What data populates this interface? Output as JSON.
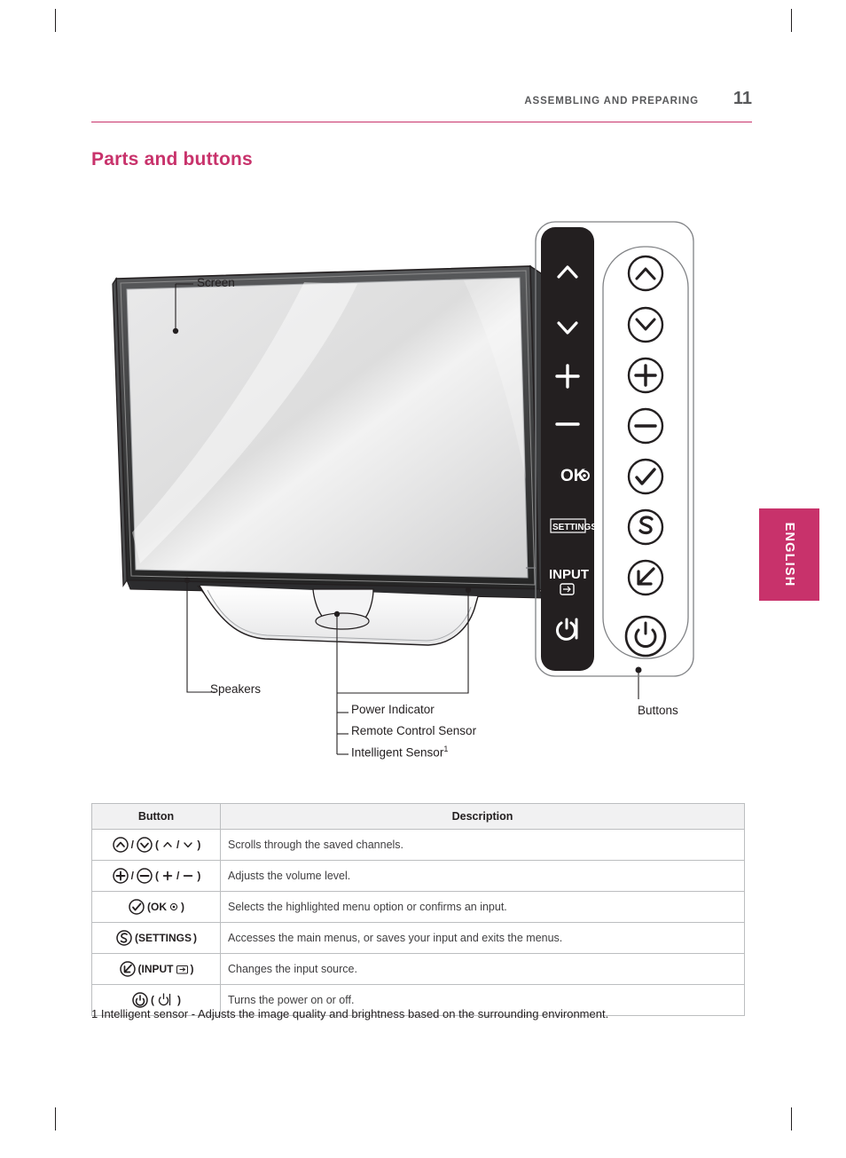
{
  "header": {
    "breadcrumb": "ASSEMBLING AND PREPARING",
    "page_number": "11",
    "accent_color": "#c8326b"
  },
  "section": {
    "title": "Parts and buttons"
  },
  "side_tab": {
    "label": "ENGLISH"
  },
  "diagram": {
    "callouts": {
      "screen": "Screen",
      "speakers": "Speakers",
      "power_indicator": "Power Indicator",
      "remote_control_sensor": "Remote Control Sensor",
      "intelligent_sensor": "Intelligent Sensor",
      "intelligent_sensor_sup": "1",
      "buttons": "Buttons"
    },
    "panel_labels": {
      "ok": "OK",
      "settings": "SETTINGS",
      "input": "INPUT"
    }
  },
  "table": {
    "headers": {
      "button": "Button",
      "description": "Description"
    },
    "rows": [
      {
        "icons": "channel-up-down",
        "label_open": "(",
        "label_close": ")",
        "description": "Scrolls through the saved channels."
      },
      {
        "icons": "volume-plus-minus",
        "label_open": "(",
        "label_close": ")",
        "description": "Adjusts the volume level."
      },
      {
        "icons": "ok-check",
        "label": "(OK",
        "label_close": ")",
        "description": "Selects the highlighted menu option or confirms an input."
      },
      {
        "icons": "settings",
        "label": "(SETTINGS",
        "label_close": ")",
        "description": "Accesses the main menus, or saves your input and exits the menus."
      },
      {
        "icons": "input",
        "label": "(INPUT",
        "label_close": ")",
        "description": "Changes the input source."
      },
      {
        "icons": "power",
        "label": "(",
        "label_close": ")",
        "description": "Turns the power on or off."
      }
    ]
  },
  "footnote": {
    "text": "1 Intelligent sensor - Adjusts the image quality and brightness based on the surrounding environment."
  }
}
